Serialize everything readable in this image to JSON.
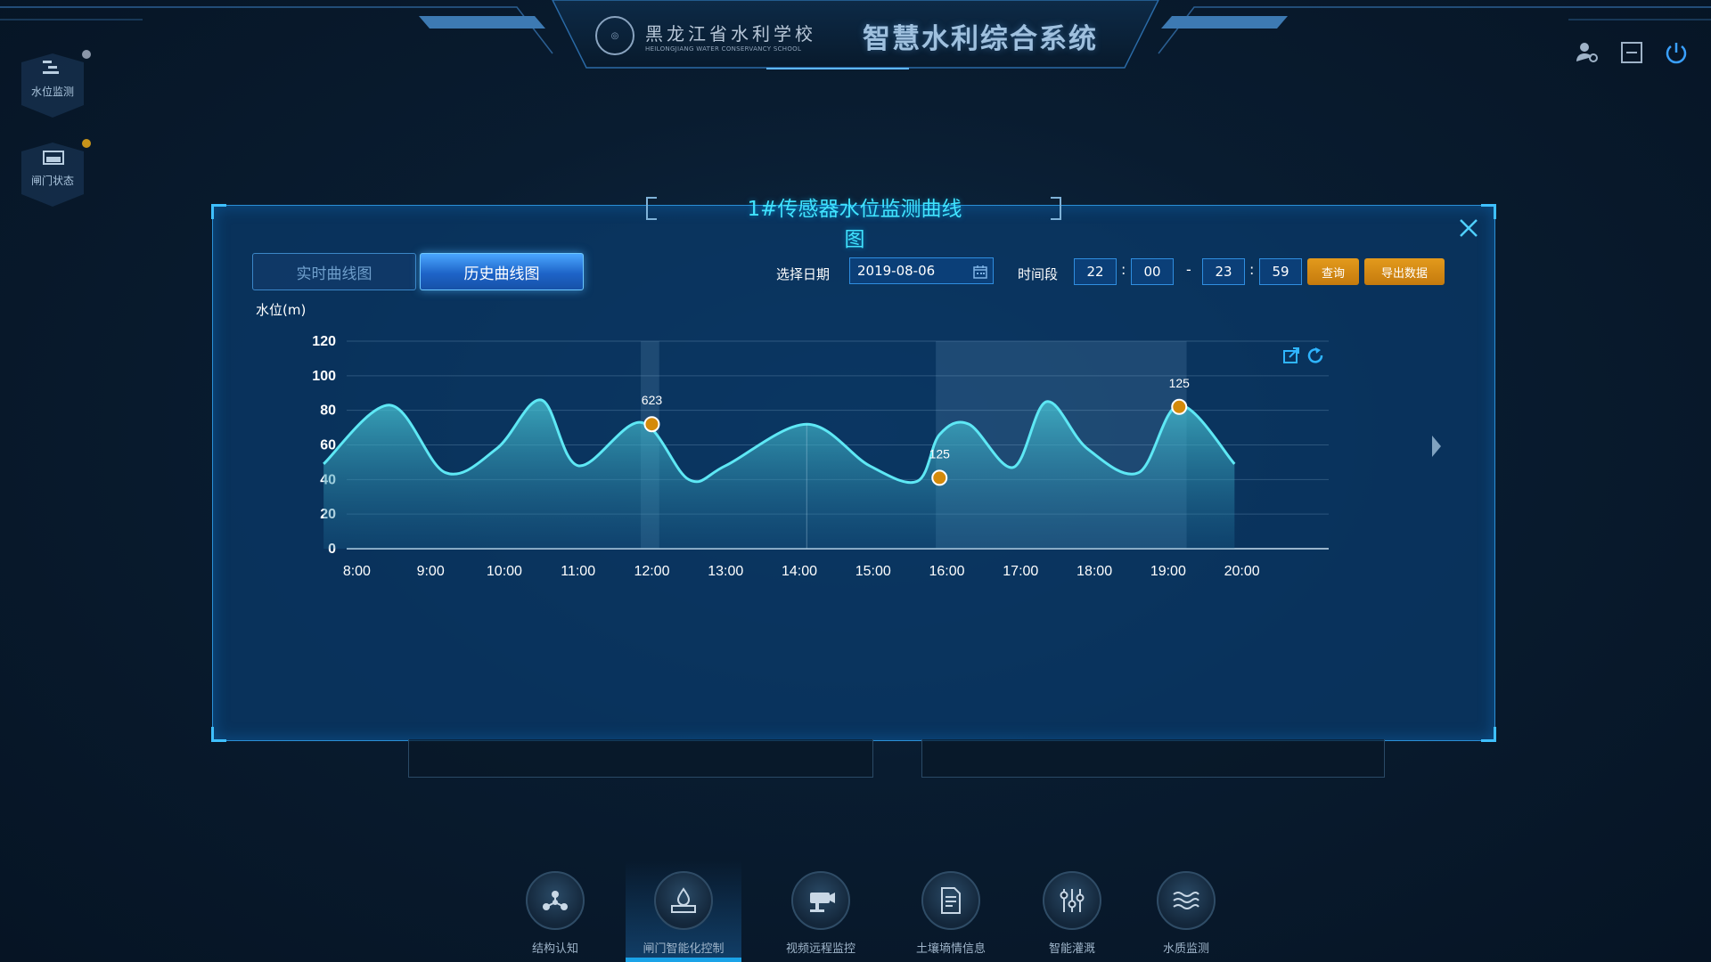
{
  "header": {
    "school_name_cn": "黑龙江省水利学校",
    "school_name_en": "HEILONGJIANG WATER CONSERVANCY SCHOOL",
    "system_title": "智慧水利综合系统",
    "icons": [
      "user-settings-icon",
      "minimize-icon",
      "power-icon"
    ]
  },
  "side_nav": [
    {
      "label": "水位监测",
      "icon": "water-level-icon",
      "status_color": "#8a96a8"
    },
    {
      "label": "闸门状态",
      "icon": "gate-icon",
      "status_color": "#c8941a"
    }
  ],
  "modal": {
    "title": "1#传感器水位监测曲线图",
    "tabs": [
      {
        "label": "实时曲线图",
        "active": false
      },
      {
        "label": "历史曲线图",
        "active": true
      }
    ],
    "date_label": "选择日期",
    "date_value": "2019-08-06",
    "period_label": "时间段",
    "start_hour": "22",
    "start_min": "00",
    "range_sep": "-",
    "end_hour": "23",
    "end_min": "59",
    "query_button": "查询",
    "export_button": "导出数据"
  },
  "chart_data": {
    "type": "area",
    "ylabel": "水位(m)",
    "ylim": [
      0,
      120
    ],
    "yticks": [
      0,
      20,
      40,
      60,
      80,
      100,
      120
    ],
    "x_tick_labels": [
      "8:00",
      "9:00",
      "10:00",
      "11:00",
      "12:00",
      "13:00",
      "14:00",
      "15:00",
      "16:00",
      "17:00",
      "18:00",
      "19:00",
      "20:00"
    ],
    "series": [
      {
        "points": [
          [
            7.55,
            49
          ],
          [
            8.45,
            83
          ],
          [
            9.2,
            44
          ],
          [
            9.9,
            58
          ],
          [
            10.5,
            86
          ],
          [
            11.0,
            48
          ],
          [
            11.85,
            73
          ],
          [
            12.5,
            40
          ],
          [
            13.0,
            48
          ],
          [
            14.1,
            72
          ],
          [
            14.95,
            48
          ],
          [
            15.6,
            39
          ],
          [
            15.9,
            66
          ],
          [
            16.3,
            72
          ],
          [
            16.9,
            47
          ],
          [
            17.35,
            85
          ],
          [
            17.9,
            58
          ],
          [
            18.6,
            44
          ],
          [
            19.15,
            83
          ],
          [
            19.9,
            49
          ]
        ],
        "color": "#5ee8f5"
      }
    ],
    "markers": [
      {
        "x": 12.0,
        "y": 72,
        "label": "623"
      },
      {
        "x": 15.9,
        "y": 41,
        "label": "125"
      },
      {
        "x": 19.15,
        "y": 82,
        "label": "125"
      }
    ],
    "highlight_ranges": [
      [
        11.85,
        12.1
      ],
      [
        15.85,
        19.25
      ]
    ],
    "vertical_lines": [
      14.1
    ],
    "toolbar": [
      "export-image-icon",
      "refresh-icon"
    ],
    "has_next_arrow": true
  },
  "bottom_nav": [
    {
      "label": "结构认知",
      "icon": "structure-icon",
      "active": false
    },
    {
      "label": "闸门智能化控制",
      "icon": "gate-control-icon",
      "active": true
    },
    {
      "label": "视频远程监控",
      "icon": "camera-icon",
      "active": false
    },
    {
      "label": "土壤墒情信息",
      "icon": "document-icon",
      "active": false
    },
    {
      "label": "智能灌溉",
      "icon": "sliders-icon",
      "active": false
    },
    {
      "label": "水质监测",
      "icon": "water-waves-icon",
      "active": false
    }
  ]
}
